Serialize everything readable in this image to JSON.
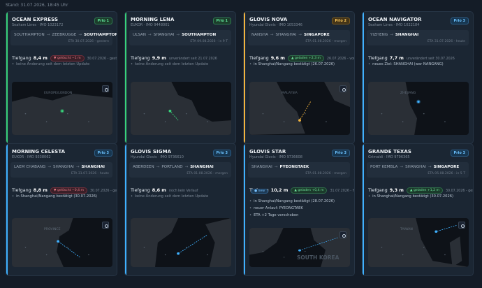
{
  "header": {
    "stand": "Stand: 31.07.2026, 18:45 Uhr"
  },
  "colors": {
    "green": "#38d17a",
    "blue": "#3fb1ff",
    "yellow": "#f2b33d"
  },
  "cards": [
    {
      "name": "OCEAN EXPRESS",
      "sub": "Seaham Lines · IMO 1023172",
      "prio": "Prio 1",
      "prio_type": "green",
      "route": [
        "SOUTHAMPTON",
        "ZEEBRUGGE",
        "SOUTHAMPTON"
      ],
      "eta": "ETA 30.07.2026 - gestern",
      "draft_label": "Tiefgang",
      "draft": "8,4 m",
      "badge": "▼ gelöscht −1 m",
      "badge_type": "down",
      "badge_note": "30.07.2026 - gestern",
      "notes": [
        "keine Änderung seit dem letzten Update"
      ],
      "notes_muted": true,
      "map_label": "EUROPE/LONDON"
    },
    {
      "name": "MORNING LENA",
      "sub": "EUKOR · IMO 9448001",
      "prio": "Prio 1",
      "prio_type": "green",
      "route": [
        "ULSAN",
        "SHANGHAI",
        "SOUTHAMPTON"
      ],
      "eta": "ETA 09.08.2026 - in 9 T",
      "draft_label": "Tiefgang",
      "draft": "9,9 m",
      "badge_note": "unverändert seit 21.07.2026",
      "notes": [
        "keine Änderung seit dem letzten Update"
      ],
      "notes_muted": true
    },
    {
      "name": "GLOVIS NOVA",
      "sub": "Hyundai Glovis · IMO 1053346",
      "prio": "Prio 2",
      "prio_type": "yellow",
      "route": [
        "NANSHA",
        "SHANGHAI",
        "SINGAPORE"
      ],
      "eta": "ETA 01.08.2026 - morgen",
      "draft_label": "Tiefgang",
      "draft": "9,6 m",
      "badge": "▲ geladen +2,3 m",
      "badge_type": "up",
      "badge_note": "26.07.2026 - vor 5 T",
      "notes": [
        "in Shanghai/Nangang bestätigt (26.07.2026)"
      ],
      "notes_muted": false,
      "map_label": "MALAYSIA"
    },
    {
      "name": "OCEAN NAVIGATOR",
      "sub": "Seaham Lines · IMO 1022184",
      "prio": "Prio 3",
      "prio_type": "blue",
      "route": [
        "YIZHENG",
        "SHANGHAI"
      ],
      "eta": "ETA 31.07.2026 - heute",
      "draft_label": "Tiefgang",
      "draft": "7,7 m",
      "badge_note": "unverändert seit 30.07.2026",
      "notes": [
        "neues Ziel: SHANGHAI (war NANGANG)"
      ],
      "notes_muted": false,
      "map_label": "ZHEJIANG"
    },
    {
      "name": "MORNING CELESTA",
      "sub": "EUKOR · IMO 9338062",
      "prio": "Prio 3",
      "prio_type": "blue",
      "route": [
        "LAEM CHABANG",
        "SHANGHAI",
        "SHANGHAI"
      ],
      "eta": "ETA 31.07.2026 - heute",
      "draft_label": "Tiefgang",
      "draft": "8,8 m",
      "badge": "▼ gelöscht −0,4 m",
      "badge_type": "down",
      "badge_note": "30.07.2026 - gestern",
      "notes": [
        "in Shanghai/Nangang bestätigt (30.07.2026)"
      ],
      "notes_muted": false,
      "map_label": "PROVINCE"
    },
    {
      "name": "GLOVIS SIGMA",
      "sub": "Hyundai Glovis · IMO 9736610",
      "prio": "Prio 3",
      "prio_type": "blue",
      "route": [
        "ABERDEEN",
        "PORTLAND",
        "SHANGHAI"
      ],
      "eta": "ETA 01.08.2026 - morgen",
      "draft_label": "Tiefgang",
      "draft": "8,6 m",
      "badge_note": "noch kein Verlauf",
      "notes": [
        "keine Änderung seit dem letzten Update"
      ],
      "notes_muted": true
    },
    {
      "name": "GLOVIS STAR",
      "sub": "Hyundai Glovis · IMO 9736608",
      "prio": "Prio 3",
      "prio_type": "blue",
      "route": [
        "SHANGHAI",
        "PYEONGTAEK"
      ],
      "eta": "ETA 01.08.2026 - morgen",
      "draft_label": "Tiefgang",
      "draft": "10,2 m",
      "badge": "▲ geladen +0,4 m",
      "badge_type": "up",
      "badge_note": "31.07.2026 - heute",
      "new_label": "● new",
      "notes": [
        "in Shanghai/Nangang bestätigt (28.07.2026)",
        "neuer Anlauf: PYEONGTAEK",
        "ETA +2 Tage verschoben"
      ],
      "notes_muted": false,
      "map_label": "SOUTH KOREA"
    },
    {
      "name": "GRANDE TEXAS",
      "sub": "Grimaldi · IMO 9796365",
      "prio": "Prio 3",
      "prio_type": "blue",
      "route": [
        "PORT KEMBLA",
        "SHANGHAI",
        "SINGAPORE"
      ],
      "eta": "ETA 05.08.2026 - in 5 T",
      "draft_label": "Tiefgang",
      "draft": "9,3 m",
      "badge": "▲ geladen +1,2 m",
      "badge_type": "up",
      "badge_note": "30.07.2026 - gestern",
      "notes": [
        "in Shanghai/Nangang bestätigt (30.07.2026)"
      ],
      "notes_muted": false,
      "map_label": "TAIWAN"
    }
  ]
}
